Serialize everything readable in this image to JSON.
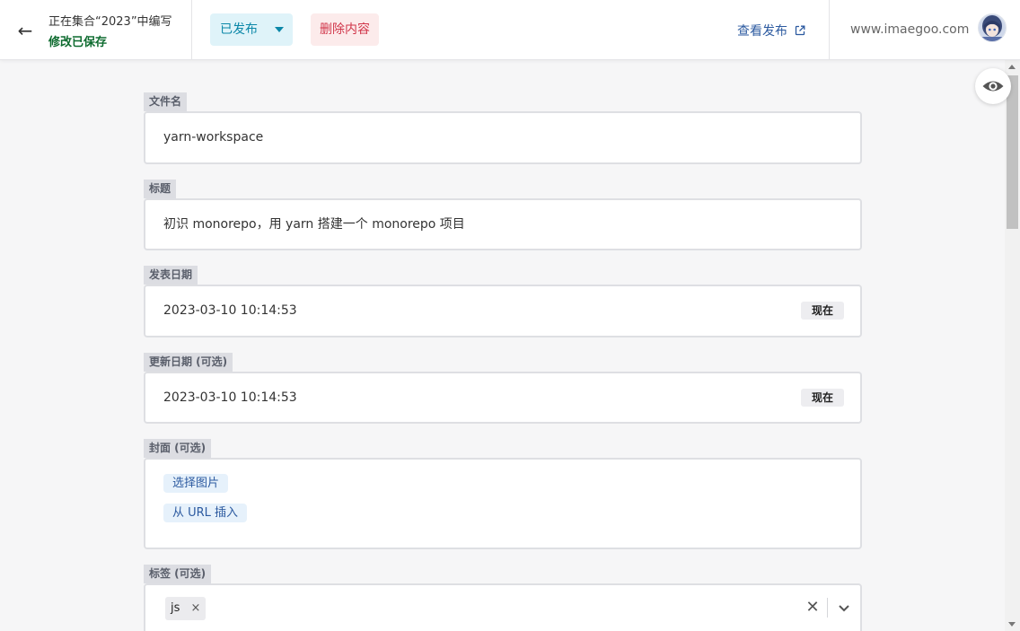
{
  "header": {
    "back_icon": "←",
    "editing_text": "正在集合“2023”中编写",
    "saved_text": "修改已保存",
    "status_label": "已发布",
    "delete_label": "删除内容",
    "view_label": "查看发布",
    "site": "www.imaegoo.com"
  },
  "fields": {
    "filename": {
      "label": "文件名",
      "value": "yarn-workspace"
    },
    "title": {
      "label": "标题",
      "value": "初识 monorepo，用 yarn 搭建一个 monorepo 项目"
    },
    "publish_date": {
      "label": "发表日期",
      "value": "2023-03-10 10:14:53",
      "now_label": "现在"
    },
    "update_date": {
      "label": "更新日期 (可选)",
      "value": "2023-03-10 10:14:53",
      "now_label": "现在"
    },
    "cover": {
      "label": "封面 (可选)",
      "choose_label": "选择图片",
      "url_label": "从 URL 插入"
    },
    "tags": {
      "label": "标签 (可选)",
      "items": [
        "js"
      ],
      "remove_icon": "×",
      "clear_icon": "✕"
    }
  },
  "colors": {
    "status_bg": "#dff3f9",
    "status_text": "#0b87a8",
    "delete_bg": "#fcebeb",
    "delete_text": "#d1364a",
    "saved_text": "#0e6b2f",
    "link": "#2c5aa0"
  },
  "icons": {
    "back": "arrow-left-icon",
    "status_caret": "caret-down-icon",
    "external": "external-link-icon",
    "preview": "eye-icon",
    "tag_dropdown": "chevron-down-icon"
  }
}
